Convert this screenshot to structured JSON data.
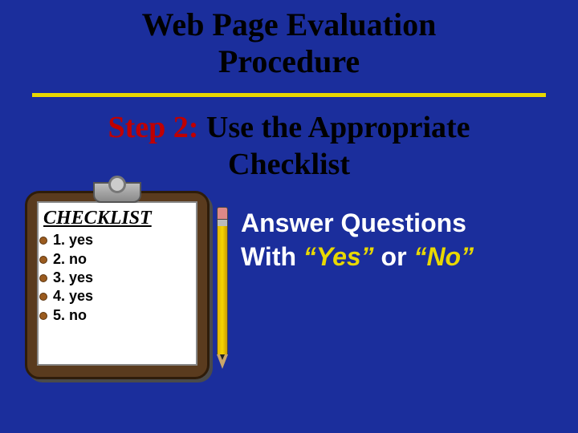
{
  "title_line1": "Web Page Evaluation",
  "title_line2": "Procedure",
  "step": {
    "prefix": "Step 2:",
    "rest_line1": " Use the Appropriate",
    "rest_line2": "Checklist"
  },
  "clipboard": {
    "heading": "CHECKLIST",
    "items": [
      "1. yes",
      "2. no",
      "3. yes",
      "4. yes",
      "5. no"
    ]
  },
  "answer": {
    "line1": "Answer Questions",
    "with": "With ",
    "yes": "“Yes”",
    "or": " or ",
    "no": "“No”"
  }
}
